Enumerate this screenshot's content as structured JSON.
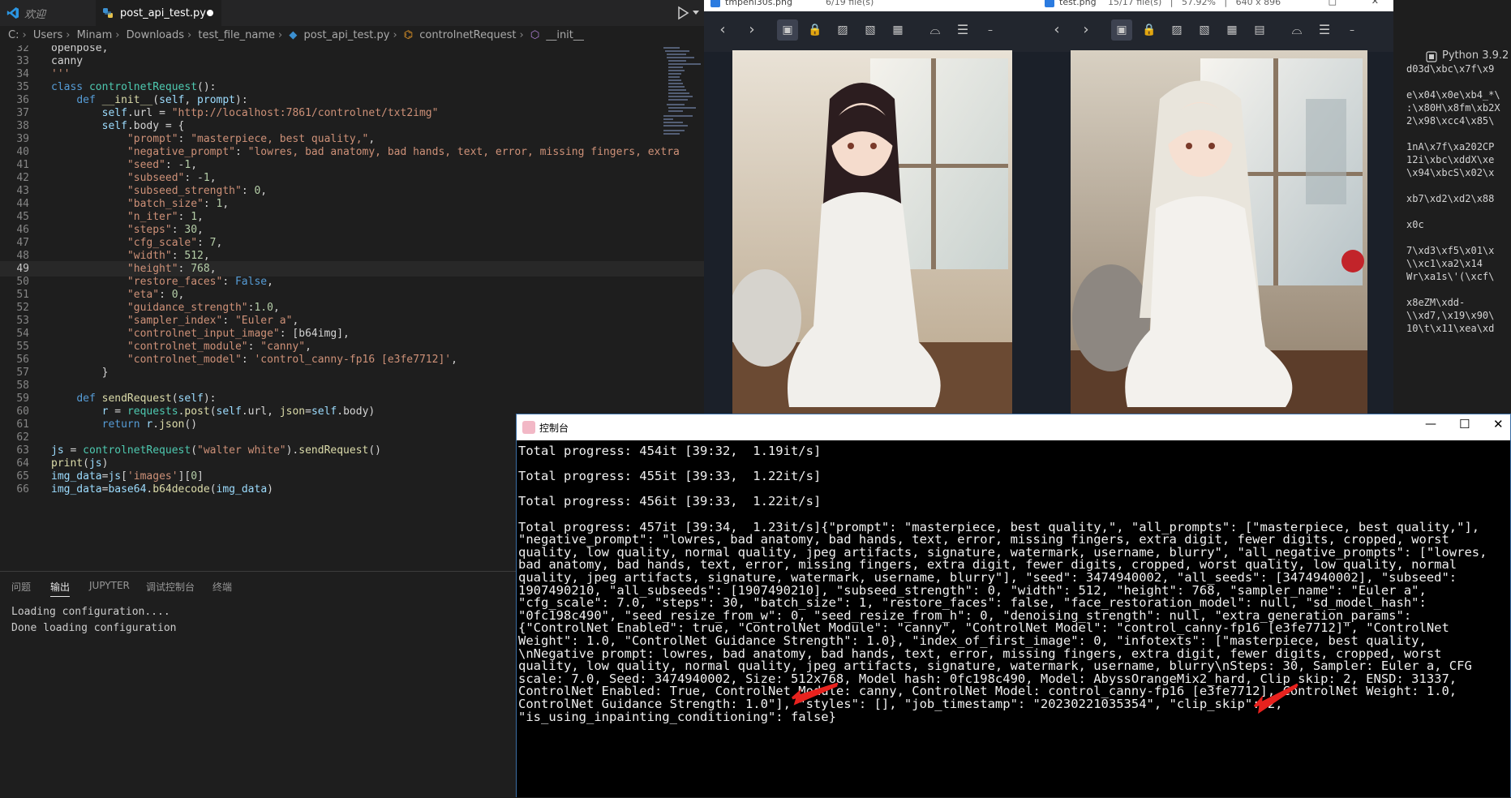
{
  "vscode": {
    "tabs": [
      {
        "label": "欢迎",
        "icon": "vscode-icon"
      },
      {
        "label": "post_api_test.py",
        "modified": true,
        "icon": "python-icon"
      }
    ],
    "run_icon": "play-icon",
    "breadcrumb": [
      "C:",
      "Users",
      "Minam",
      "Downloads",
      "test_file_name",
      "post_api_test.py",
      "controlnetRequest",
      "__init__"
    ],
    "code_lines": [
      {
        "n": "32",
        "t": "openpose,"
      },
      {
        "n": "33",
        "t": "canny"
      },
      {
        "n": "34",
        "t": "'''"
      },
      {
        "n": "35",
        "t": "class controlnetRequest():"
      },
      {
        "n": "36",
        "t": "    def __init__(self, prompt):"
      },
      {
        "n": "37",
        "t": "        self.url = \"http://localhost:7861/controlnet/txt2img\""
      },
      {
        "n": "38",
        "t": "        self.body = {"
      },
      {
        "n": "39",
        "t": "            \"prompt\": \"masterpiece, best quality,\","
      },
      {
        "n": "40",
        "t": "            \"negative_prompt\": \"lowres, bad anatomy, bad hands, text, error, missing fingers, extra"
      },
      {
        "n": "41",
        "t": "            \"seed\": -1,"
      },
      {
        "n": "42",
        "t": "            \"subseed\": -1,"
      },
      {
        "n": "43",
        "t": "            \"subseed_strength\": 0,"
      },
      {
        "n": "44",
        "t": "            \"batch_size\": 1,"
      },
      {
        "n": "45",
        "t": "            \"n_iter\": 1,"
      },
      {
        "n": "46",
        "t": "            \"steps\": 30,"
      },
      {
        "n": "47",
        "t": "            \"cfg_scale\": 7,"
      },
      {
        "n": "48",
        "t": "            \"width\": 512,"
      },
      {
        "n": "49",
        "t": "            \"height\": 768,"
      },
      {
        "n": "50",
        "t": "            \"restore_faces\": False,"
      },
      {
        "n": "51",
        "t": "            \"eta\": 0,"
      },
      {
        "n": "52",
        "t": "            \"guidance_strength\":1.0,"
      },
      {
        "n": "53",
        "t": "            \"sampler_index\": \"Euler a\","
      },
      {
        "n": "54",
        "t": "            \"controlnet_input_image\": [b64img],"
      },
      {
        "n": "55",
        "t": "            \"controlnet_module\": \"canny\","
      },
      {
        "n": "56",
        "t": "            \"controlnet_model\": 'control_canny-fp16 [e3fe7712]',"
      },
      {
        "n": "57",
        "t": "        }"
      },
      {
        "n": "58",
        "t": ""
      },
      {
        "n": "59",
        "t": "    def sendRequest(self):"
      },
      {
        "n": "60",
        "t": "        r = requests.post(self.url, json=self.body)"
      },
      {
        "n": "61",
        "t": "        return r.json()"
      },
      {
        "n": "62",
        "t": ""
      },
      {
        "n": "63",
        "t": "js = controlnetRequest(\"walter white\").sendRequest()"
      },
      {
        "n": "64",
        "t": "print(js)"
      },
      {
        "n": "65",
        "t": "img_data=js['images'][0]"
      },
      {
        "n": "66",
        "t": "img_data=base64.b64decode(img_data)"
      }
    ],
    "current_line": "49",
    "panel_tabs": [
      "问题",
      "输出",
      "JUPYTER",
      "调试控制台",
      "终端"
    ],
    "active_panel_tab": "输出",
    "output_lines": [
      "Loading configuration....",
      "Done loading configuration"
    ],
    "python_version": "Python 3.9.2",
    "hex_lines": [
      "d03d\\xbc\\x7f\\x9",
      "",
      "e\\x04\\x0e\\xb4_*\\",
      ":\\x80H\\x8fm\\xb2X",
      "2\\x98\\xcc4\\x85\\",
      "",
      "1nA\\x7f\\xa202CP",
      "12i\\xbc\\xddX\\xe",
      "\\x94\\xbcS\\x02\\x",
      "",
      "xb7\\xd2\\xd2\\x88",
      "",
      "x0c",
      "",
      "7\\xd3\\xf5\\x01\\x",
      "\\\\xc1\\xa2\\x14",
      "Wr\\xa1s\\'(\\xcf\\",
      "",
      "x8eZM\\xdd-",
      "\\\\xd7,\\x19\\x90\\",
      "10\\t\\x11\\xea\\xd"
    ]
  },
  "viewer_left": {
    "title": "tmpeni30s.png",
    "info": "6/19 file(s)",
    "image_caption": "Generated anime girl in white dress, dark hair, sitting by window"
  },
  "viewer_right": {
    "title": "test.png",
    "info": "15/17 file(s)   |   57.92%   |   640 x 896",
    "image_caption": "Generated anime girl in white dress, light hair, sitting by window"
  },
  "console": {
    "title": "控制台",
    "lines": [
      "Total progress: 454it [39:32,  1.19it/s]",
      "",
      "Total progress: 455it [39:33,  1.22it/s]",
      "",
      "Total progress: 456it [39:33,  1.22it/s]",
      "",
      "Total progress: 457it [39:34,  1.23it/s]{\"prompt\": \"masterpiece, best quality,\", \"all_prompts\": [\"masterpiece, best quality,\"],",
      "\"negative_prompt\": \"lowres, bad anatomy, bad hands, text, error, missing fingers, extra digit, fewer digits, cropped, worst",
      "quality, low quality, normal quality, jpeg artifacts, signature, watermark, username, blurry\", \"all_negative_prompts\": [\"lowres,",
      "bad anatomy, bad hands, text, error, missing fingers, extra digit, fewer digits, cropped, worst quality, low quality, normal",
      "quality, jpeg artifacts, signature, watermark, username, blurry\"], \"seed\": 3474940002, \"all_seeds\": [3474940002], \"subseed\":",
      "1907490210, \"all_subseeds\": [1907490210], \"subseed_strength\": 0, \"width\": 512, \"height\": 768, \"sampler_name\": \"Euler a\",",
      "\"cfg_scale\": 7.0, \"steps\": 30, \"batch_size\": 1, \"restore_faces\": false, \"face_restoration_model\": null, \"sd_model_hash\":",
      "\"0fc198c490\", \"seed_resize_from_w\": 0, \"seed_resize_from_h\": 0, \"denoising_strength\": null, \"extra_generation_params\":",
      "{\"ControlNet Enabled\": true, \"ControlNet Module\": \"canny\", \"ControlNet Model\": \"control_canny-fp16 [e3fe7712]\", \"ControlNet",
      "Weight\": 1.0, \"ControlNet Guidance Strength\": 1.0}, \"index_of_first_image\": 0, \"infotexts\": [\"masterpiece, best quality,",
      "\\nNegative prompt: lowres, bad anatomy, bad hands, text, error, missing fingers, extra digit, fewer digits, cropped, worst",
      "quality, low quality, normal quality, jpeg artifacts, signature, watermark, username, blurry\\nSteps: 30, Sampler: Euler a, CFG",
      "scale: 7.0, Seed: 3474940002, Size: 512x768, Model hash: 0fc198c490, Model: AbyssOrangeMix2_hard, Clip skip: 2, ENSD: 31337,",
      "ControlNet Enabled: True, ControlNet Module: canny, ControlNet Model: control_canny-fp16 [e3fe7712], ControlNet Weight: 1.0,",
      "ControlNet Guidance Strength: 1.0\"], \"styles\": [], \"job_timestamp\": \"20230221035354\", \"clip_skip\": 2,",
      "\"is_using_inpainting_conditioning\": false}"
    ]
  },
  "colors": {
    "keyword": "#569cd6",
    "string": "#ce9178",
    "class_name": "#4ec9b0",
    "function": "#dcdcaa",
    "variable": "#9cdcfe",
    "number": "#b5cea8",
    "annotation_arrow": "#e8221e"
  }
}
